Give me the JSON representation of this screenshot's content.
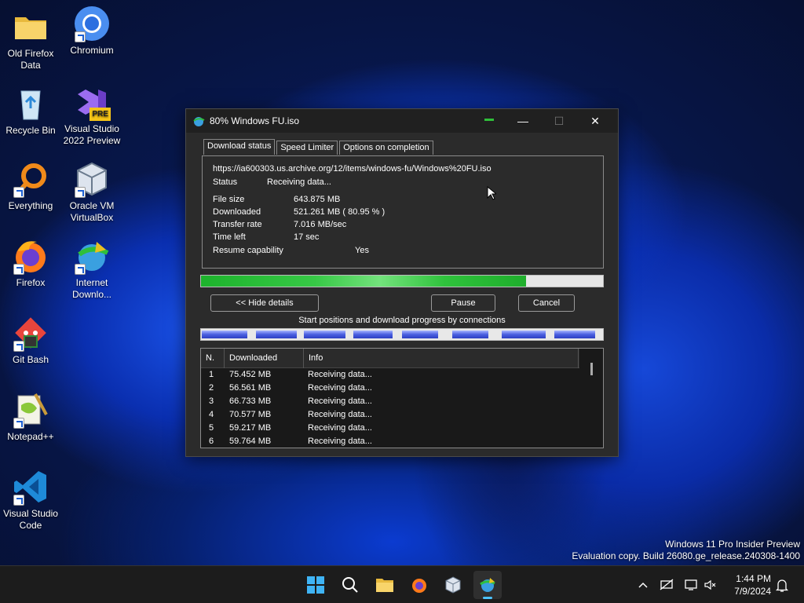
{
  "desktop": {
    "icons": [
      {
        "label": "Old Firefox Data"
      },
      {
        "label": "Chromium"
      },
      {
        "label": "Recycle Bin"
      },
      {
        "label": "Visual Studio 2022 Preview",
        "badge": "PRE"
      },
      {
        "label": "Everything"
      },
      {
        "label": "Oracle VM VirtualBox"
      },
      {
        "label": "Firefox"
      },
      {
        "label": "Internet Downlo..."
      },
      {
        "label": "Git Bash"
      },
      {
        "label": "Notepad++"
      },
      {
        "label": "Visual Studio Code"
      }
    ]
  },
  "window": {
    "title": "80% Windows FU.iso",
    "controls": {
      "minimize": "—",
      "maximize": "☐",
      "close": "✕"
    },
    "tabs": [
      {
        "label": "Download status",
        "active": true
      },
      {
        "label": "Speed Limiter",
        "active": false
      },
      {
        "label": "Options on completion",
        "active": false
      }
    ],
    "url": "https://ia600303.us.archive.org/12/items/windows-fu/Windows%20FU.iso",
    "status": {
      "label": "Status",
      "value": "Receiving data..."
    },
    "details": {
      "file_size": {
        "label": "File size",
        "value": "643.875  MB"
      },
      "downloaded": {
        "label": "Downloaded",
        "value": "521.261  MB  ( 80.95 % )"
      },
      "transfer_rate": {
        "label": "Transfer rate",
        "value": "7.016  MB/sec"
      },
      "time_left": {
        "label": "Time left",
        "value": "17 sec"
      },
      "resume": {
        "label": "Resume capability",
        "value": "Yes"
      }
    },
    "progress_fraction": 0.8095,
    "buttons": {
      "hide_details": "<< Hide details",
      "pause": "Pause",
      "cancel": "Cancel"
    },
    "connections_caption": "Start positions and download progress by connections",
    "connections_table": {
      "headers": [
        "N.",
        "Downloaded",
        "Info"
      ],
      "rows": [
        {
          "n": "1",
          "downloaded": "75.452  MB",
          "info": "Receiving data..."
        },
        {
          "n": "2",
          "downloaded": "56.561  MB",
          "info": "Receiving data..."
        },
        {
          "n": "3",
          "downloaded": "66.733  MB",
          "info": "Receiving data..."
        },
        {
          "n": "4",
          "downloaded": "70.577  MB",
          "info": "Receiving data..."
        },
        {
          "n": "5",
          "downloaded": "59.217  MB",
          "info": "Receiving data..."
        },
        {
          "n": "6",
          "downloaded": "59.764  MB",
          "info": "Receiving data..."
        }
      ]
    }
  },
  "watermark": {
    "line1": "Windows 11 Pro Insider Preview",
    "line2": "Evaluation copy. Build 26080.ge_release.240308-1400"
  },
  "taskbar": {
    "apps": [
      "start-icon",
      "search-icon",
      "file-explorer-icon",
      "firefox-icon",
      "virtualbox-icon",
      "internet-download-manager-icon"
    ],
    "tray_icons": [
      "chevron-up-icon",
      "network-icon",
      "display-icon",
      "volume-muted-icon",
      "notification-bell-icon"
    ],
    "time": "1:44 PM",
    "date": "7/9/2024"
  },
  "colors": {
    "accent": "#4cc2ff",
    "progress_green": "#2fc23c",
    "connection_blue": "#3b4fd0",
    "window_bg": "#2b2b2b"
  }
}
